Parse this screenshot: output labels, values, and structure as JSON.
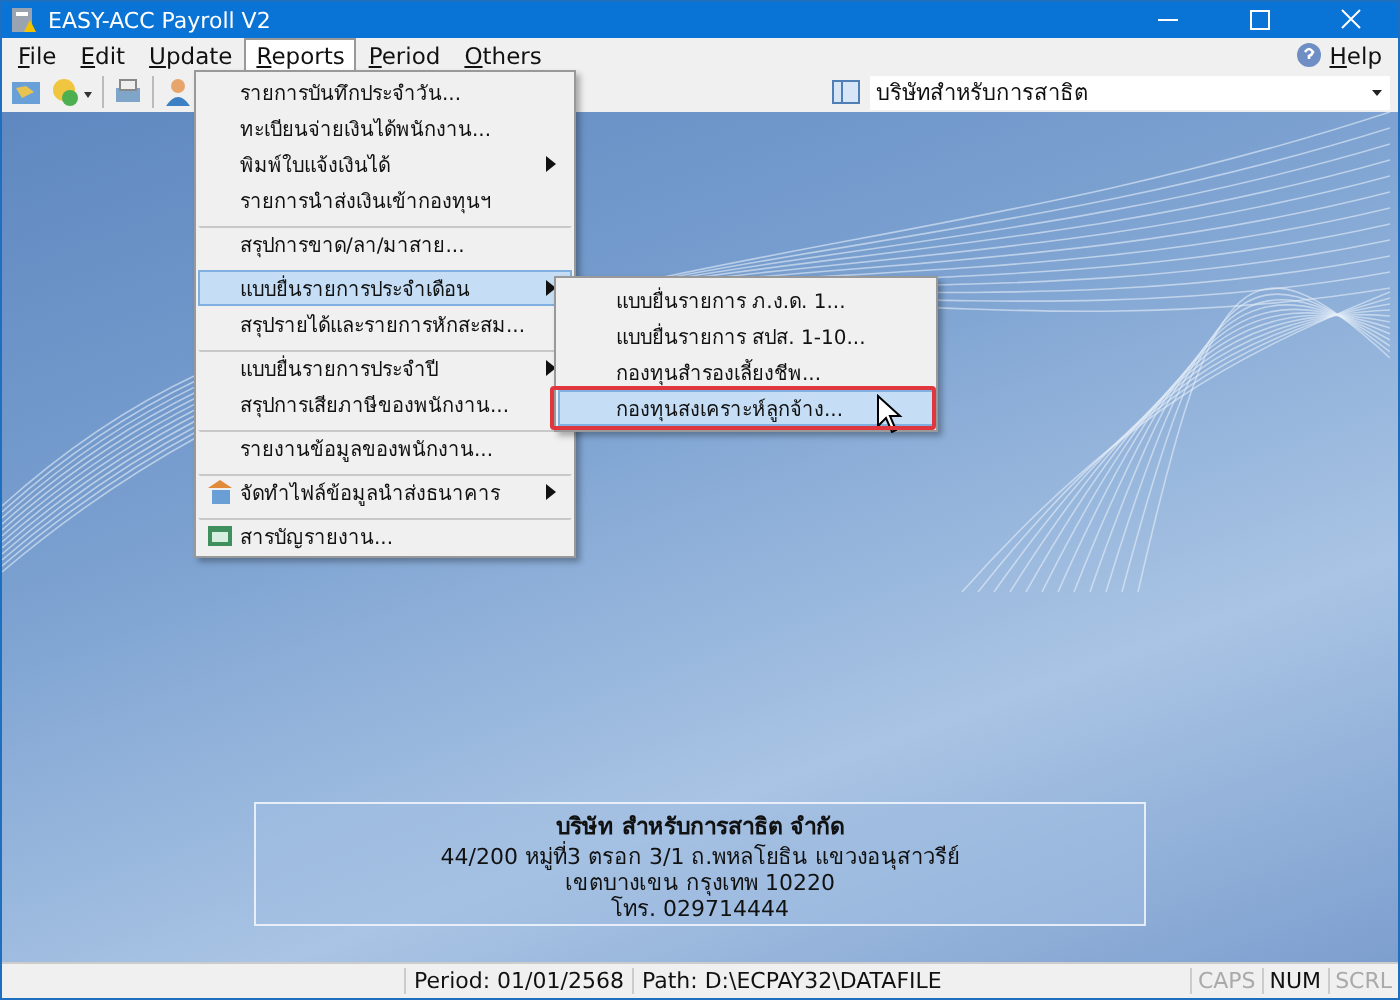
{
  "window": {
    "title": "EASY-ACC Payroll V2"
  },
  "menubar": [
    {
      "label": "File",
      "selected": false
    },
    {
      "label": "Edit",
      "selected": false
    },
    {
      "label": "Update",
      "selected": false
    },
    {
      "label": "Reports",
      "selected": true
    },
    {
      "label": "Period",
      "selected": false
    },
    {
      "label": "Others",
      "selected": false
    }
  ],
  "help": {
    "label": "Help"
  },
  "company_selector": {
    "value": "บริษัทสำหรับการสาธิต"
  },
  "reports_menu": [
    {
      "label": "รายการบันทึกประจำวัน...",
      "separator_before": false,
      "has_submenu": false,
      "selected": false
    },
    {
      "label": "ทะเบียนจ่ายเงินได้พนักงาน...",
      "separator_before": false,
      "has_submenu": false,
      "selected": false
    },
    {
      "label": "พิมพ์ใบแจ้งเงินได้",
      "separator_before": false,
      "has_submenu": true,
      "selected": false
    },
    {
      "label": "รายการนำส่งเงินเข้ากองทุนฯ",
      "separator_before": false,
      "has_submenu": false,
      "selected": false
    },
    {
      "label": "สรุปการขาด/ลา/มาสาย...",
      "separator_before": true,
      "has_submenu": false,
      "selected": false
    },
    {
      "label": "แบบยื่นรายการประจำเดือน",
      "separator_before": true,
      "has_submenu": true,
      "selected": true
    },
    {
      "label": "สรุปรายได้และรายการหักสะสม...",
      "separator_before": false,
      "has_submenu": false,
      "selected": false
    },
    {
      "label": "แบบยื่นรายการประจำปี",
      "separator_before": true,
      "has_submenu": true,
      "selected": false
    },
    {
      "label": "สรุปการเสียภาษีของพนักงาน...",
      "separator_before": false,
      "has_submenu": false,
      "selected": false
    },
    {
      "label": "รายงานข้อมูลของพนักงาน...",
      "separator_before": true,
      "has_submenu": false,
      "selected": false
    },
    {
      "label": "จัดทำไฟล์ข้อมูลนำส่งธนาคาร",
      "separator_before": true,
      "has_submenu": true,
      "selected": false
    },
    {
      "label": "สารบัญรายงาน...",
      "separator_before": true,
      "has_submenu": false,
      "selected": false
    }
  ],
  "submenu": [
    {
      "label": "แบบยื่นรายการ ภ.ง.ด. 1...",
      "selected": false
    },
    {
      "label": "แบบยื่นรายการ สปส. 1-10...",
      "selected": false
    },
    {
      "label": "กองทุนสำรองเลี้ยงชีพ...",
      "selected": false
    },
    {
      "label": "กองทุนสงเคราะห์ลูกจ้าง...",
      "selected": true
    }
  ],
  "company_info": {
    "name": "บริษัท สำหรับการสาธิต จำกัด",
    "lines": [
      "44/200 หมู่ที่3 ตรอก 3/1 ถ.พหลโยธิน แขวงอนุสาวรีย์",
      "เขตบางเขน กรุงเทพ 10220",
      "โทร. 029714444"
    ]
  },
  "status_bar": {
    "period": "Period: 01/01/2568",
    "path": "Path: D:\\ECPAY32\\DATAFILE",
    "indicators": [
      {
        "label": "CAPS",
        "on": false
      },
      {
        "label": "NUM",
        "on": true
      },
      {
        "label": "SCRL",
        "on": false
      }
    ]
  }
}
